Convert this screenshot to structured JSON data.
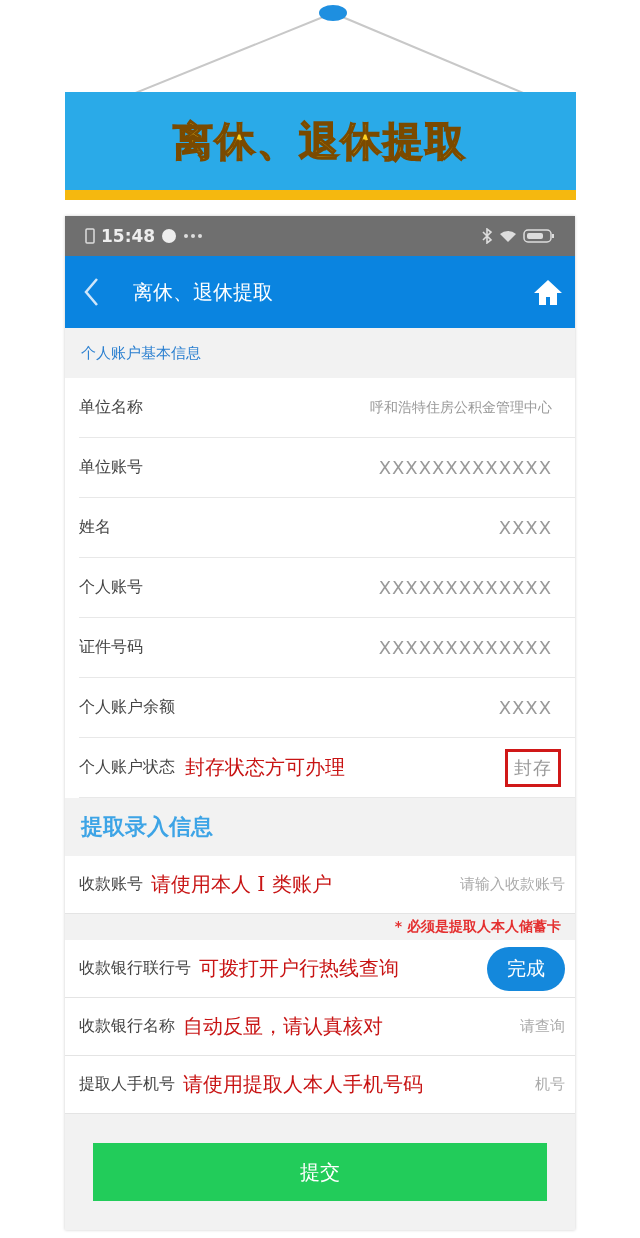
{
  "banner": {
    "title": "离休、退休提取"
  },
  "status_bar": {
    "time": "15:48"
  },
  "header": {
    "title": "离休、退休提取"
  },
  "account_section": {
    "title": "个人账户基本信息"
  },
  "info_rows": [
    {
      "label": "单位名称",
      "value": "呼和浩特住房公积金管理中心",
      "boxed": false
    },
    {
      "label": "单位账号",
      "value": "XXXXXXXXXXXXX",
      "boxed": false
    },
    {
      "label": "姓名",
      "value": "XXXX",
      "boxed": false
    },
    {
      "label": "个人账号",
      "value": "XXXXXXXXXXXXX",
      "boxed": false
    },
    {
      "label": "证件号码",
      "value": "XXXXXXXXXXXXX",
      "boxed": false
    },
    {
      "label": "个人账户余额",
      "value": "XXXX",
      "boxed": false
    },
    {
      "label": "个人账户状态",
      "note": "封存状态方可办理",
      "value": "封存",
      "boxed": true
    }
  ],
  "entry_section": {
    "title": "提取录入信息"
  },
  "entry_rows": [
    {
      "kind": "input",
      "label": "收款账号",
      "note": "请使用本人 I 类账户",
      "placeholder": "请输入收款账号",
      "hint": "* 必须是提取人本人储蓄卡"
    },
    {
      "kind": "button",
      "label": "收款银行联行号",
      "note": "可拨打开户行热线查询",
      "button": "完成"
    },
    {
      "kind": "input",
      "label": "收款银行名称",
      "note": "自动反显，请认真核对",
      "placeholder": "请查询"
    },
    {
      "kind": "input",
      "label": "提取人手机号",
      "note": "请使用提取人本人手机号码",
      "placeholder": "机号"
    }
  ],
  "submit_button": "提交"
}
